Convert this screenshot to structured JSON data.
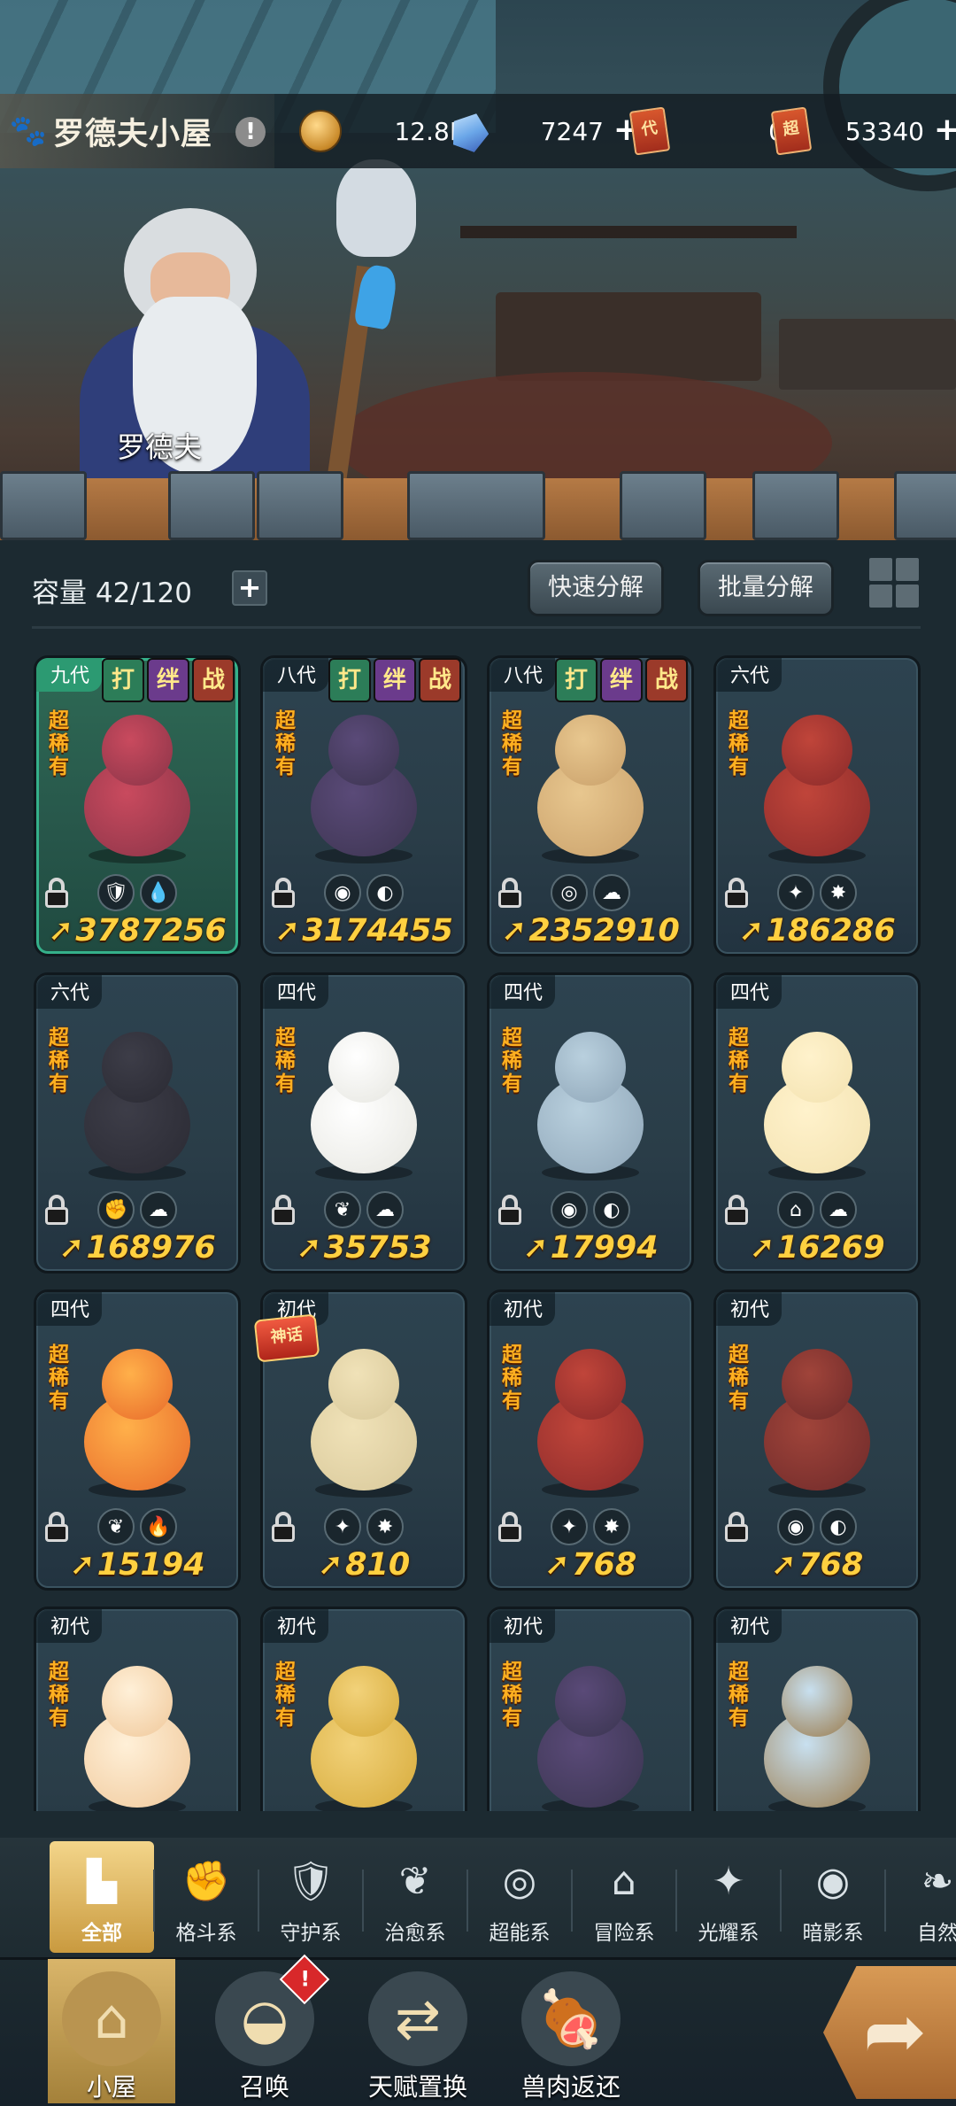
{
  "header": {
    "title": "罗德夫小屋",
    "info_icon": "!",
    "resources": [
      {
        "name": "gold",
        "icon": "gold-coin-icon",
        "value": "12.8M"
      },
      {
        "name": "crystal",
        "icon": "crystal-icon",
        "value": "7247",
        "plus": "+"
      },
      {
        "name": "ticket-a",
        "icon": "ticket-icon",
        "glyph": "代",
        "value": "0"
      },
      {
        "name": "ticket-b",
        "icon": "ticket-icon",
        "glyph": "超",
        "value": "53340",
        "plus": "+"
      }
    ]
  },
  "npc": {
    "name": "罗德夫"
  },
  "capacity": {
    "label": "容量 42/120",
    "plus": "+"
  },
  "actions": {
    "quick_decompose": "快速分解",
    "batch_decompose": "批量分解"
  },
  "cards": [
    {
      "gen": "九代",
      "tags": [
        "打",
        "绊",
        "战"
      ],
      "rarity": "超稀有",
      "power": "3787256",
      "types": [
        "🛡",
        "💧"
      ],
      "highlight": true
    },
    {
      "gen": "八代",
      "tags": [
        "打",
        "绊",
        "战"
      ],
      "rarity": "超稀有",
      "power": "3174455",
      "types": [
        "◉",
        "◐"
      ]
    },
    {
      "gen": "八代",
      "tags": [
        "打",
        "绊",
        "战"
      ],
      "rarity": "超稀有",
      "power": "2352910",
      "types": [
        "◎",
        "☁"
      ]
    },
    {
      "gen": "六代",
      "tags": [],
      "rarity": "超稀有",
      "power": "186286",
      "types": [
        "✦",
        "✸"
      ]
    },
    {
      "gen": "六代",
      "tags": [],
      "rarity": "超稀有",
      "power": "168976",
      "types": [
        "✊",
        "☁"
      ]
    },
    {
      "gen": "四代",
      "tags": [],
      "rarity": "超稀有",
      "power": "35753",
      "types": [
        "❦",
        "☁"
      ]
    },
    {
      "gen": "四代",
      "tags": [],
      "rarity": "超稀有",
      "power": "17994",
      "types": [
        "◉",
        "◐"
      ]
    },
    {
      "gen": "四代",
      "tags": [],
      "rarity": "超稀有",
      "power": "16269",
      "types": [
        "⌂",
        "☁"
      ]
    },
    {
      "gen": "四代",
      "tags": [],
      "rarity": "超稀有",
      "power": "15194",
      "types": [
        "❦",
        "🔥"
      ]
    },
    {
      "gen": "初代",
      "tags": [],
      "rarity": "",
      "power": "810",
      "types": [
        "✦",
        "✸"
      ],
      "badge": "神话"
    },
    {
      "gen": "初代",
      "tags": [],
      "rarity": "超稀有",
      "power": "768",
      "types": [
        "✦",
        "✸"
      ]
    },
    {
      "gen": "初代",
      "tags": [],
      "rarity": "超稀有",
      "power": "768",
      "types": [
        "◉",
        "◐"
      ]
    },
    {
      "gen": "初代",
      "tags": [],
      "rarity": "超稀有",
      "power": "",
      "types": []
    },
    {
      "gen": "初代",
      "tags": [],
      "rarity": "超稀有",
      "power": "",
      "types": []
    },
    {
      "gen": "初代",
      "tags": [],
      "rarity": "超稀有",
      "power": "",
      "types": []
    },
    {
      "gen": "初代",
      "tags": [],
      "rarity": "超稀有",
      "power": "",
      "types": []
    }
  ],
  "filters": [
    {
      "label": "全部",
      "icon": "all-blocks-icon",
      "glyph": "▙",
      "active": true
    },
    {
      "label": "格斗系",
      "icon": "fist-icon",
      "glyph": "✊"
    },
    {
      "label": "守护系",
      "icon": "shield-icon",
      "glyph": "🛡"
    },
    {
      "label": "治愈系",
      "icon": "sprout-icon",
      "glyph": "❦"
    },
    {
      "label": "超能系",
      "icon": "alien-icon",
      "glyph": "◎"
    },
    {
      "label": "冒险系",
      "icon": "lantern-icon",
      "glyph": "⌂"
    },
    {
      "label": "光耀系",
      "icon": "star-burst-icon",
      "glyph": "✦"
    },
    {
      "label": "暗影系",
      "icon": "eclipse-icon",
      "glyph": "◉"
    },
    {
      "label": "自然",
      "icon": "leaf-icon",
      "glyph": "❧"
    }
  ],
  "nav": [
    {
      "label": "小屋",
      "icon": "house-icon",
      "glyph": "⌂",
      "active": true
    },
    {
      "label": "召唤",
      "icon": "egg-icon",
      "glyph": "◒",
      "badge": "!"
    },
    {
      "label": "天赋置换",
      "icon": "swap-icon",
      "glyph": "⇄"
    },
    {
      "label": "兽肉返还",
      "icon": "meat-icon",
      "glyph": "🍖"
    }
  ],
  "go_button": {
    "icon": "forward-arrow-icon",
    "glyph": "➦"
  },
  "colors": {
    "accent_gold": "#ffd040",
    "rarity_orange": "#ffb020",
    "card_bg": "#2d4350",
    "highlight_card": "#2e6a55"
  }
}
